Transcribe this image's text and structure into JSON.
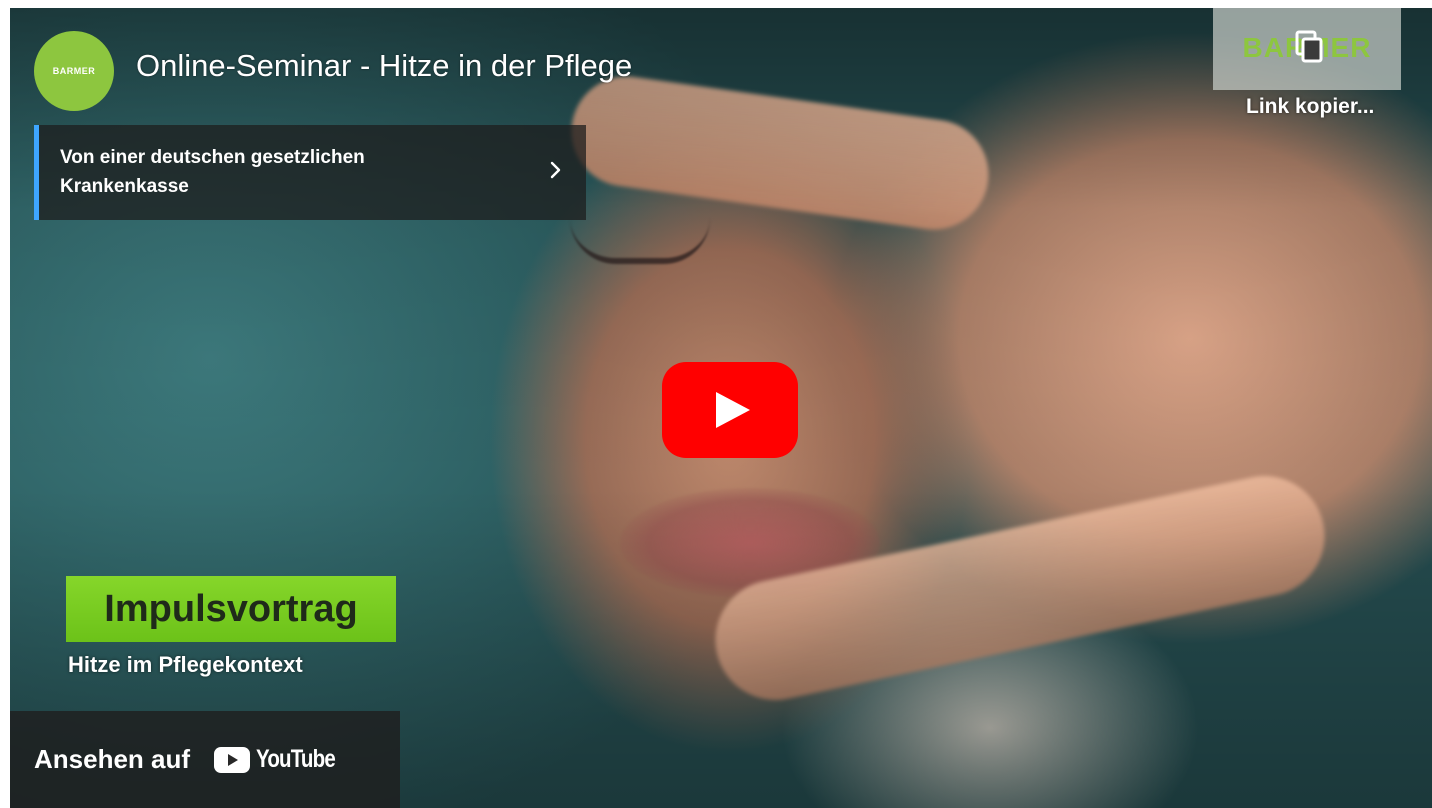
{
  "player": {
    "title": "Online-Seminar - Hitze in der Pflege",
    "channel": {
      "avatar_text": "BARMER",
      "avatar_color": "#8dc63f"
    },
    "info_panel": {
      "text": "Von einer deutschen gesetzlichen Krankenkasse",
      "accent_color": "#3ea6ff",
      "icon": "chevron-right-icon"
    },
    "watermark": {
      "text": "BARMER",
      "icon": "copy-link-icon"
    },
    "share": {
      "label": "Link kopier..."
    },
    "play_button": {
      "icon": "youtube-play-icon",
      "color": "#ff0000"
    },
    "overlay": {
      "badge_text": "Impulsvortrag",
      "badge_color": "#7ed321",
      "subtitle": "Hitze im Pflegekontext"
    },
    "watch_on": {
      "label": "Ansehen auf",
      "logo_text": "YouTube",
      "icon": "youtube-logo-icon"
    }
  }
}
